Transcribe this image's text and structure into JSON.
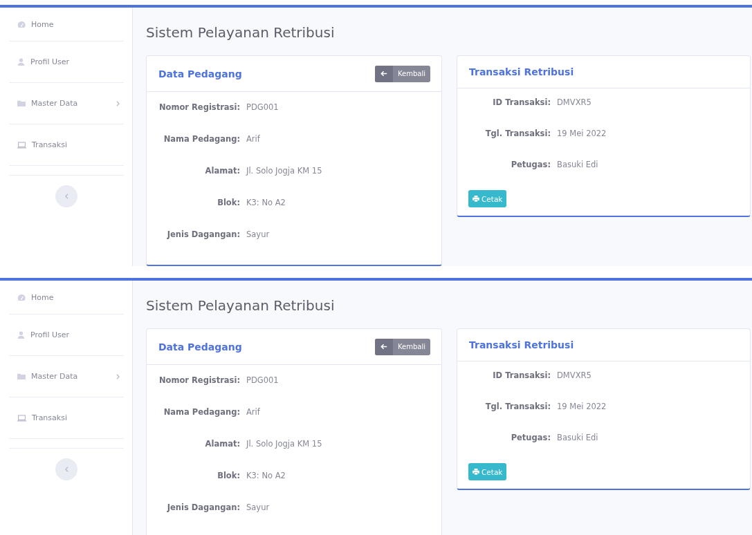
{
  "screens": [
    {
      "sidebar": {
        "items": [
          {
            "label": "Home",
            "submenu": false
          },
          {
            "label": "Profil User",
            "submenu": false
          },
          {
            "label": "Master Data",
            "submenu": true
          },
          {
            "label": "Transaksi",
            "submenu": false
          }
        ]
      },
      "page_title": "Sistem Pelayanan Retribusi",
      "merchant_card": {
        "title": "Data Pedagang",
        "back_button": "Kembali",
        "fields": [
          {
            "label": "Nomor Registrasi:",
            "value": "PDG001"
          },
          {
            "label": "Nama Pedagang:",
            "value": "Arif"
          },
          {
            "label": "Alamat:",
            "value": "Jl. Solo Jogja KM 15"
          },
          {
            "label": "Blok:",
            "value": "K3: No A2"
          },
          {
            "label": "Jenis Dagangan:",
            "value": "Sayur"
          }
        ]
      },
      "transaction_card": {
        "title": "Transaksi Retribusi",
        "fields": [
          {
            "label": "ID Transaksi:",
            "value": "DMVXR5"
          },
          {
            "label": "Tgl. Transaksi:",
            "value": "19 Mei 2022"
          },
          {
            "label": "Petugas:",
            "value": "Basuki Edi"
          }
        ],
        "print_button": "Cetak"
      }
    },
    {
      "sidebar": {
        "items": [
          {
            "label": "Home",
            "submenu": false
          },
          {
            "label": "Profil User",
            "submenu": false
          },
          {
            "label": "Master Data",
            "submenu": true
          },
          {
            "label": "Transaksi",
            "submenu": false
          }
        ]
      },
      "page_title": "Sistem Pelayanan Retribusi",
      "merchant_card": {
        "title": "Data Pedagang",
        "back_button": "Kembali",
        "fields": [
          {
            "label": "Nomor Registrasi:",
            "value": "PDG001"
          },
          {
            "label": "Nama Pedagang:",
            "value": "Arif"
          },
          {
            "label": "Alamat:",
            "value": "Jl. Solo Jogja KM 15"
          },
          {
            "label": "Blok:",
            "value": "K3: No A2"
          },
          {
            "label": "Jenis Dagangan:",
            "value": "Sayur"
          }
        ]
      },
      "transaction_card": {
        "title": "Transaksi Retribusi",
        "fields": [
          {
            "label": "ID Transaksi:",
            "value": "DMVXR5"
          },
          {
            "label": "Tgl. Transaksi:",
            "value": "19 Mei 2022"
          },
          {
            "label": "Petugas:",
            "value": "Basuki Edi"
          }
        ],
        "print_button": "Cetak"
      }
    }
  ]
}
